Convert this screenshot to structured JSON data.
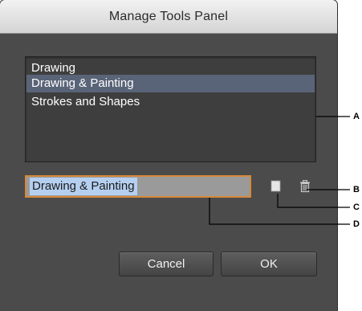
{
  "dialog": {
    "title": "Manage Tools Panel"
  },
  "panel_list": {
    "items": [
      {
        "label": "Drawing",
        "selected": false
      },
      {
        "label": "Drawing & Painting",
        "selected": true
      },
      {
        "label": "Strokes and Shapes",
        "selected": false
      }
    ],
    "selected_color": "#5a6478"
  },
  "name_field": {
    "value": "Drawing & Painting",
    "focus_color": "#d7893a"
  },
  "icons": {
    "new": "new-panel-icon",
    "delete": "trash-icon"
  },
  "buttons": {
    "cancel_label": "Cancel",
    "ok_label": "OK"
  },
  "callouts": {
    "a": "A",
    "b": "B",
    "c": "C",
    "d": "D"
  }
}
